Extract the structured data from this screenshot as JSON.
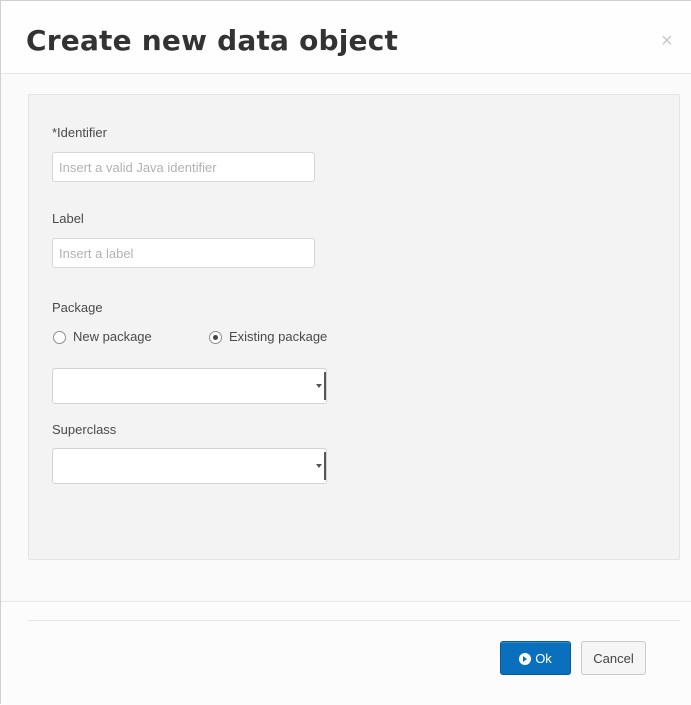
{
  "dialog": {
    "title": "Create new data object",
    "close_label": "×"
  },
  "form": {
    "identifier": {
      "label": "*Identifier",
      "placeholder": "Insert a valid Java identifier",
      "value": ""
    },
    "label_field": {
      "label": "Label",
      "placeholder": "Insert a label",
      "value": ""
    },
    "package": {
      "label": "Package",
      "options": [
        {
          "label": "New package",
          "checked": false
        },
        {
          "label": "Existing package",
          "checked": true
        }
      ],
      "selected": ""
    },
    "superclass": {
      "label": "Superclass",
      "selected": ""
    }
  },
  "footer": {
    "ok_label": "Ok",
    "cancel_label": "Cancel",
    "ok_icon": "play-circle-icon"
  },
  "colors": {
    "primary": "#0a6fbd",
    "well_bg": "#f3f3f3"
  }
}
